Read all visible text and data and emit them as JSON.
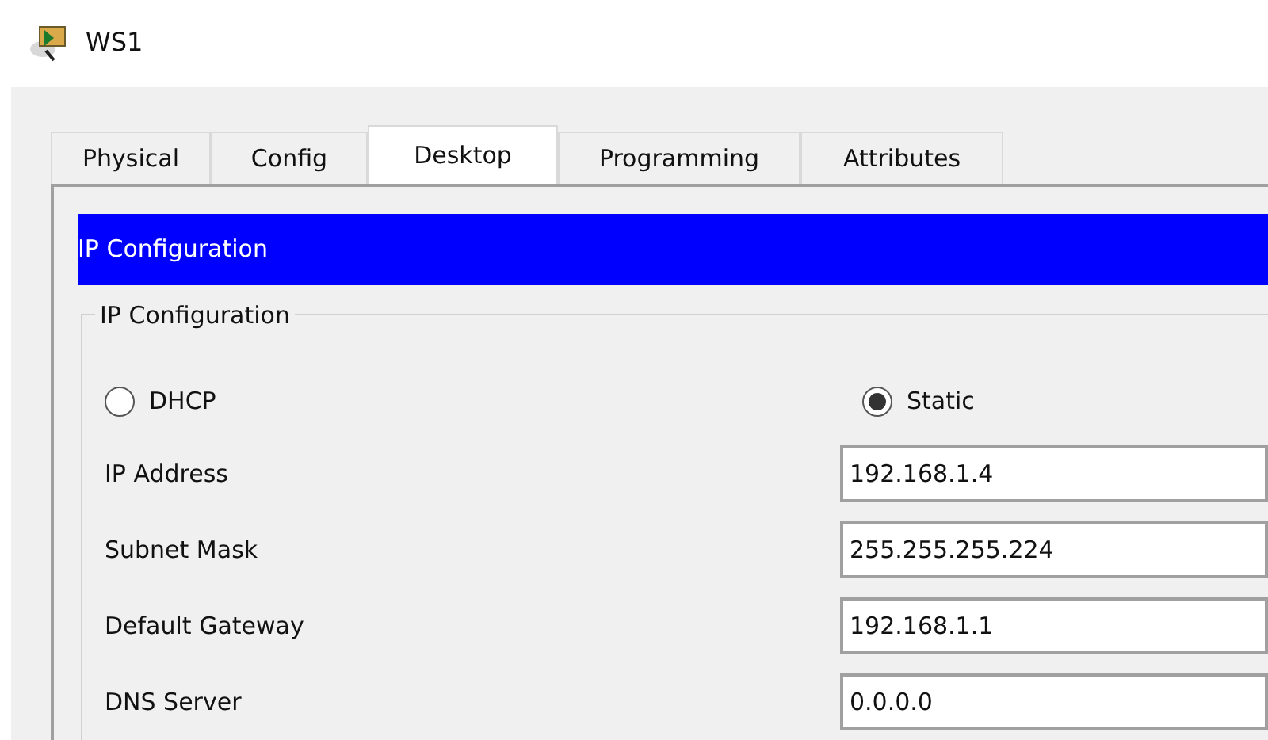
{
  "window": {
    "title": "WS1"
  },
  "tabs": [
    {
      "label": "Physical",
      "selected": false
    },
    {
      "label": "Config",
      "selected": false
    },
    {
      "label": "Desktop",
      "selected": true
    },
    {
      "label": "Programming",
      "selected": false
    },
    {
      "label": "Attributes",
      "selected": false
    }
  ],
  "section_header": "IP Configuration",
  "group": {
    "title": "IP Configuration",
    "modes": [
      {
        "label": "DHCP",
        "selected": false
      },
      {
        "label": "Static",
        "selected": true
      }
    ],
    "fields": [
      {
        "label": "IP Address",
        "value": "192.168.1.4"
      },
      {
        "label": "Subnet Mask",
        "value": "255.255.255.224"
      },
      {
        "label": "Default Gateway",
        "value": "192.168.1.1"
      },
      {
        "label": "DNS Server",
        "value": "0.0.0.0"
      }
    ]
  }
}
